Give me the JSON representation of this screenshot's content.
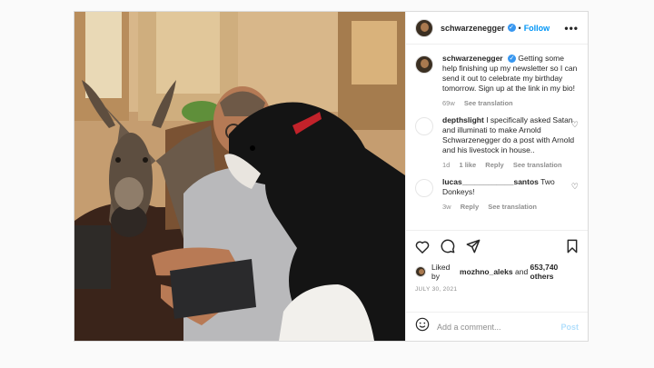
{
  "header": {
    "username": "schwarzenegger",
    "verified_icon": "verified-badge-icon",
    "separator": "•",
    "follow_label": "Follow",
    "more_label": "•••"
  },
  "caption": {
    "username": "schwarzenegger",
    "text": "Getting some help finishing up my newsletter so I can send it out to celebrate my birthday tomorrow. Sign up at the link in my bio!",
    "age": "69w",
    "translation": "See translation"
  },
  "comments": [
    {
      "username": "depthslight",
      "text": "I specifically asked Satan and illuminati to make Arnold Schwarzenegger do a post with Arnold and his livestock in house..",
      "age": "1d",
      "likes": "1 like",
      "reply": "Reply",
      "translation": "See translation"
    },
    {
      "username": "lucas____________santos",
      "text": "Two Donkeys!",
      "age": "3w",
      "reply": "Reply",
      "translation": "See translation"
    }
  ],
  "likes": {
    "prefix": "Liked by",
    "user": "mozhno_aleks",
    "joiner": "and",
    "count": "653,740 others"
  },
  "date": "JULY 30, 2021",
  "add_comment": {
    "placeholder": "Add a comment...",
    "post_label": "Post"
  },
  "colors": {
    "accent": "#0095f6",
    "verified": "#3897f0",
    "muted": "#8e8e8e"
  }
}
